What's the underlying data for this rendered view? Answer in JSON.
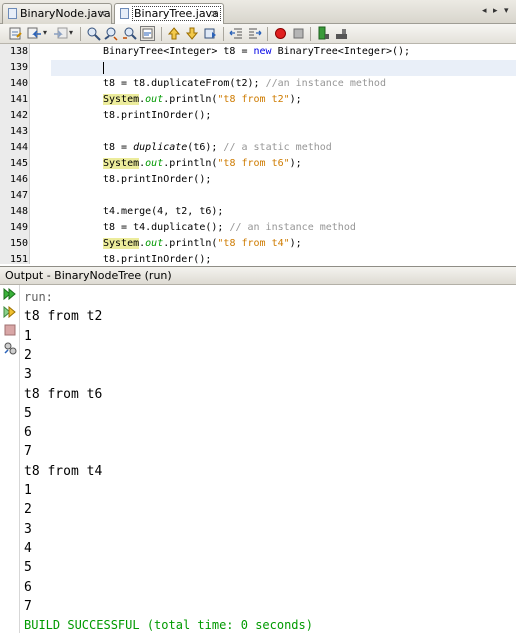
{
  "tabs": [
    {
      "label": "BinaryNode.java",
      "active": false
    },
    {
      "label": "BinaryTree.java",
      "active": true
    }
  ],
  "tab_close_glyph": "×",
  "tab_controls": {
    "left": "◂",
    "right": "▸",
    "menu": "▾"
  },
  "toolbar": {
    "icons": [
      "last-edit-icon",
      "back-icon",
      "forward-icon",
      "find-selection-icon",
      "find-previous-icon",
      "find-next-icon",
      "toggle-highlight-icon",
      "previous-bookmark-icon",
      "next-bookmark-icon",
      "toggle-bookmark-icon",
      "shift-left-icon",
      "shift-right-icon",
      "start-macro-icon",
      "stop-macro-icon",
      "comment-icon",
      "uncomment-icon"
    ]
  },
  "editor": {
    "lines": [
      {
        "num": "138",
        "segments": [
          {
            "t": "BinaryTree<Integer> t8 = ",
            "c": ""
          },
          {
            "t": "new",
            "c": "kw"
          },
          {
            "t": " BinaryTree<Integer>();",
            "c": ""
          }
        ]
      },
      {
        "num": "139",
        "segments": [],
        "current": true
      },
      {
        "num": "140",
        "segments": [
          {
            "t": "t8 = t8.duplicateFrom(t2); ",
            "c": ""
          },
          {
            "t": "//an instance method",
            "c": "cmt"
          }
        ]
      },
      {
        "num": "141",
        "segments": [
          {
            "t": "System",
            "c": "hl"
          },
          {
            "t": ".",
            "c": ""
          },
          {
            "t": "out",
            "c": "fld"
          },
          {
            "t": ".println(",
            "c": ""
          },
          {
            "t": "\"t8 from t2\"",
            "c": "str"
          },
          {
            "t": ");",
            "c": ""
          }
        ]
      },
      {
        "num": "142",
        "segments": [
          {
            "t": "t8.printInOrder();",
            "c": ""
          }
        ]
      },
      {
        "num": "143",
        "segments": []
      },
      {
        "num": "144",
        "segments": [
          {
            "t": "t8 = ",
            "c": ""
          },
          {
            "t": "duplicate",
            "c": "ital"
          },
          {
            "t": "(t6); ",
            "c": ""
          },
          {
            "t": "// a static method",
            "c": "cmt"
          }
        ]
      },
      {
        "num": "145",
        "segments": [
          {
            "t": "System",
            "c": "hl"
          },
          {
            "t": ".",
            "c": ""
          },
          {
            "t": "out",
            "c": "fld"
          },
          {
            "t": ".println(",
            "c": ""
          },
          {
            "t": "\"t8 from t6\"",
            "c": "str"
          },
          {
            "t": ");",
            "c": ""
          }
        ]
      },
      {
        "num": "146",
        "segments": [
          {
            "t": "t8.printInOrder();",
            "c": ""
          }
        ]
      },
      {
        "num": "147",
        "segments": []
      },
      {
        "num": "148",
        "segments": [
          {
            "t": "t4.merge(4, t2, t6);",
            "c": ""
          }
        ]
      },
      {
        "num": "149",
        "segments": [
          {
            "t": "t8 = t4.duplicate(); ",
            "c": ""
          },
          {
            "t": "// an instance method",
            "c": "cmt"
          }
        ]
      },
      {
        "num": "150",
        "segments": [
          {
            "t": "System",
            "c": "hl"
          },
          {
            "t": ".",
            "c": ""
          },
          {
            "t": "out",
            "c": "fld"
          },
          {
            "t": ".println(",
            "c": ""
          },
          {
            "t": "\"t8 from t4\"",
            "c": "str"
          },
          {
            "t": ");",
            "c": ""
          }
        ]
      },
      {
        "num": "151",
        "segments": [
          {
            "t": "t8.printInOrder();",
            "c": ""
          }
        ]
      }
    ]
  },
  "output": {
    "title": "Output - BinaryNodeTree (run)",
    "side_icons": [
      "rerun-icon",
      "rerun-with-options-icon",
      "stop-icon",
      "settings-icon"
    ],
    "lines": [
      {
        "text": "run:",
        "kind": "run"
      },
      {
        "text": "t8 from t2",
        "kind": ""
      },
      {
        "text": "1",
        "kind": ""
      },
      {
        "text": "2",
        "kind": ""
      },
      {
        "text": "3",
        "kind": ""
      },
      {
        "text": "t8 from t6",
        "kind": ""
      },
      {
        "text": "5",
        "kind": ""
      },
      {
        "text": "6",
        "kind": ""
      },
      {
        "text": "7",
        "kind": ""
      },
      {
        "text": "t8 from t4",
        "kind": ""
      },
      {
        "text": "1",
        "kind": ""
      },
      {
        "text": "2",
        "kind": ""
      },
      {
        "text": "3",
        "kind": ""
      },
      {
        "text": "4",
        "kind": ""
      },
      {
        "text": "5",
        "kind": ""
      },
      {
        "text": "6",
        "kind": ""
      },
      {
        "text": "7",
        "kind": ""
      },
      {
        "text": "BUILD SUCCESSFUL (total time: 0 seconds)",
        "kind": "build"
      }
    ]
  },
  "colors": {
    "keyword": "#0000e6",
    "string": "#ce7b00",
    "comment": "#969696",
    "field": "#009900",
    "system_highlight": "#ecec9c",
    "build_success": "#009a00"
  }
}
